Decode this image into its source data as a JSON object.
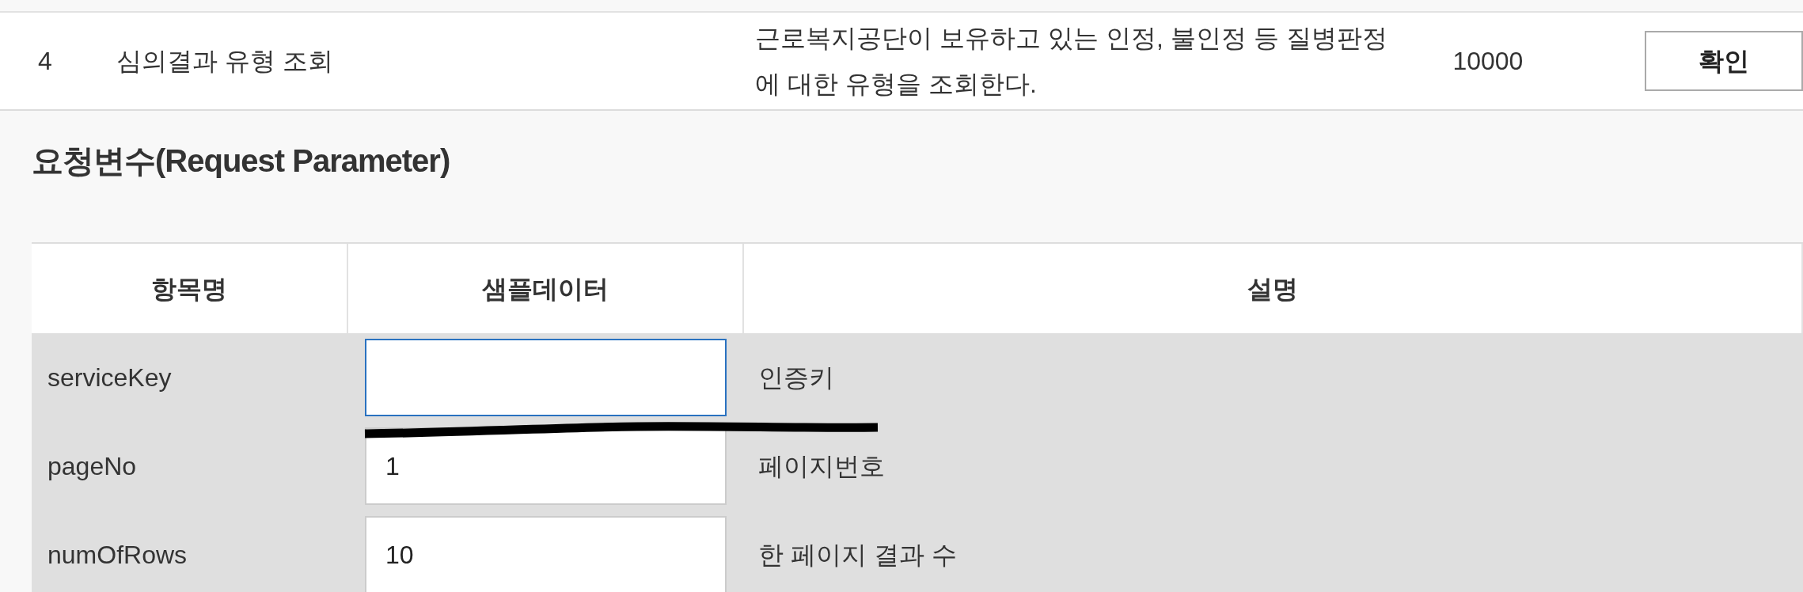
{
  "api_row": {
    "number": "4",
    "name": "심의결과 유형 조회",
    "description": "근로복지공단이 보유하고 있는 인정, 불인정 등 질병판정\n에 대한 유형을 조회한다.",
    "traffic": "10000",
    "button": "확인"
  },
  "request_parameters": {
    "title": "요청변수(Request Parameter)",
    "columns": [
      "항목명",
      "샘플데이터",
      "설명"
    ],
    "rows": [
      {
        "name": "serviceKey",
        "value": "",
        "focused": true,
        "description": "인증키"
      },
      {
        "name": "pageNo",
        "value": "1",
        "focused": false,
        "description": "페이지번호"
      },
      {
        "name": "numOfRows",
        "value": "10",
        "focused": false,
        "description": "한 페이지 결과 수"
      }
    ]
  }
}
